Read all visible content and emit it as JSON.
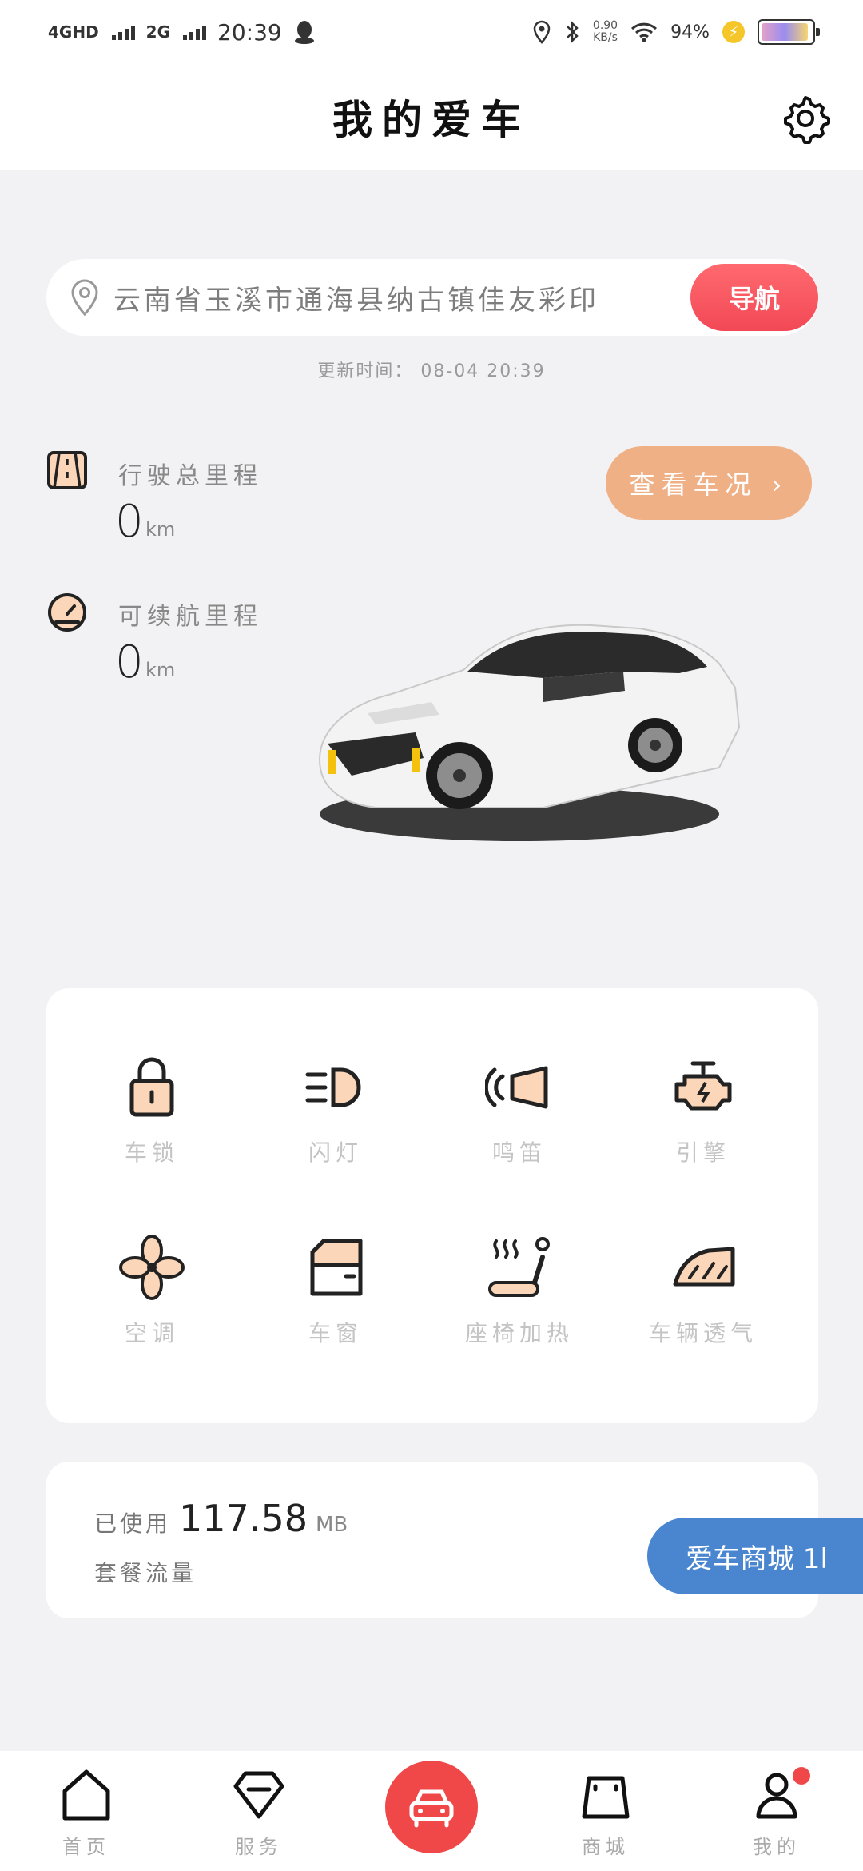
{
  "status_bar": {
    "network1": "4GHD",
    "network2": "2G",
    "time": "20:39",
    "speed_value": "0.90",
    "speed_unit": "KB/s",
    "battery": "94%"
  },
  "header": {
    "title": "我的爱车"
  },
  "location": {
    "address": "云南省玉溪市通海县纳古镇佳友彩印",
    "nav_button": "导航",
    "update_time": "更新时间： 08-04 20:39"
  },
  "stats": {
    "total_mileage": {
      "label": "行驶总里程",
      "value": "0",
      "unit": "km"
    },
    "range": {
      "label": "可续航里程",
      "value": "0",
      "unit": "km"
    }
  },
  "check_button": "查看车况 ›",
  "controls": [
    {
      "label": "车锁",
      "icon": "lock-icon"
    },
    {
      "label": "闪灯",
      "icon": "headlight-icon"
    },
    {
      "label": "鸣笛",
      "icon": "horn-icon"
    },
    {
      "label": "引擎",
      "icon": "engine-icon"
    },
    {
      "label": "空调",
      "icon": "fan-icon"
    },
    {
      "label": "车窗",
      "icon": "window-icon"
    },
    {
      "label": "座椅加热",
      "icon": "seat-heat-icon"
    },
    {
      "label": "车辆透气",
      "icon": "ventilation-icon"
    }
  ],
  "data_usage": {
    "prefix": "已使用",
    "value": "117.58",
    "unit": "MB",
    "plan_label": "套餐流量"
  },
  "mall_button": "爱车商城 1l",
  "bottom_nav": {
    "home": "首页",
    "service": "服务",
    "mall": "商城",
    "mine": "我的"
  },
  "colors": {
    "accent_red": "#f04848",
    "accent_orange": "#f0b085",
    "accent_blue": "#4a86d0",
    "icon_fill": "#fbd6b8"
  }
}
